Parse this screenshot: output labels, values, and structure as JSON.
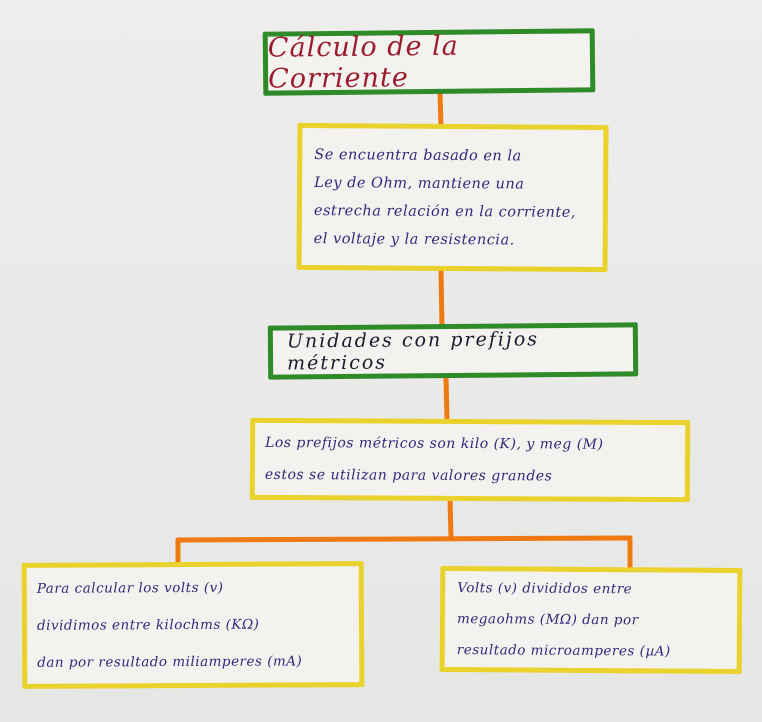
{
  "diagram": {
    "title": "Cálculo de la Corriente",
    "ohm_box": {
      "lines": [
        "Se encuentra basado en la",
        "Ley de Ohm, mantiene una",
        "estrecha relación en la corriente,",
        "el voltaje y la resistencia."
      ]
    },
    "units_heading": "Unidades con prefijos métricos",
    "prefixes_box": {
      "lines": [
        "Los prefijos métricos son kilo (K), y meg (M)",
        "estos se utilizan para valores grandes"
      ]
    },
    "left_box": {
      "lines": [
        "Para calcular los volts (v)",
        "dividimos entre kilochms (KΩ)",
        "dan por resultado miliamperes (mA)"
      ]
    },
    "right_box": {
      "lines": [
        "Volts (v) divididos entre",
        "megaohms (MΩ) dan por",
        "resultado microamperes (µA)"
      ]
    },
    "colors": {
      "title_text": "#9a1d2e",
      "body_text": "#2f2a7a",
      "green_border": "#2f8a2a",
      "yellow_border": "#e9d22c",
      "connector": "#f07a12"
    }
  }
}
